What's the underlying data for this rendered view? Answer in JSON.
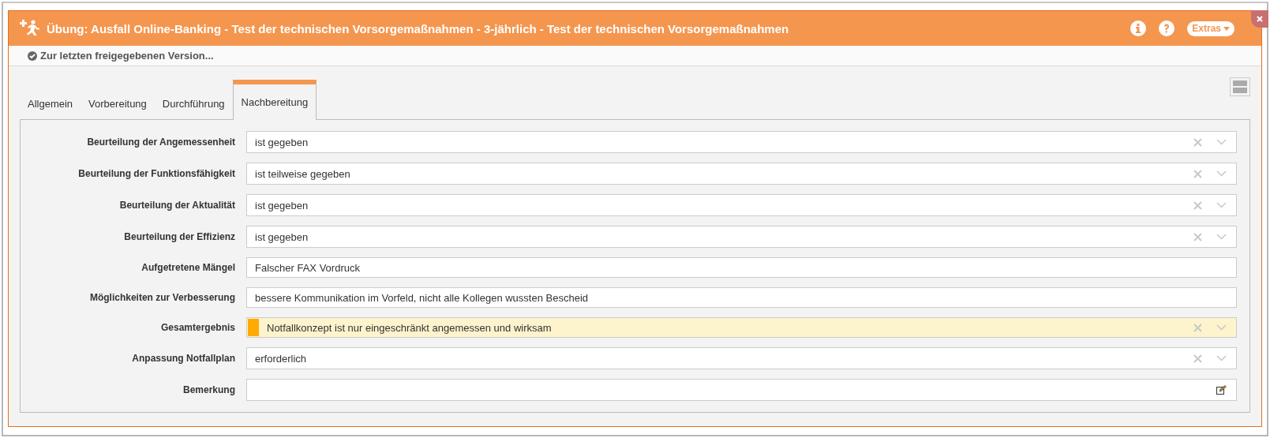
{
  "window": {
    "title": "Übung: Ausfall Online-Banking - Test der technischen Vorsorgemaßnahmen - 3-jährlich - Test der technischen Vorsorgemaßnahmen",
    "extras": "Extras"
  },
  "toolbar": {
    "link": "Zur letzten freigegebenen Version..."
  },
  "tabs": [
    {
      "label": "Allgemein",
      "selected": false
    },
    {
      "label": "Vorbereitung",
      "selected": false
    },
    {
      "label": "Durchführung",
      "selected": false
    },
    {
      "label": "Nachbereitung",
      "selected": true
    }
  ],
  "fields": [
    {
      "kind": "select",
      "label": "Beurteilung der Angemessenheit",
      "value": "ist gegeben"
    },
    {
      "kind": "select",
      "label": "Beurteilung der Funktionsfähigkeit",
      "value": "ist teilweise gegeben"
    },
    {
      "kind": "select",
      "label": "Beurteilung der Aktualität",
      "value": "ist gegeben"
    },
    {
      "kind": "select",
      "label": "Beurteilung der Effizienz",
      "value": "ist gegeben"
    },
    {
      "kind": "text",
      "label": "Aufgetretene Mängel",
      "value": "Falscher FAX Vordruck"
    },
    {
      "kind": "text",
      "label": "Möglichkeiten zur Verbesserung",
      "value": "bessere Kommunikation im Vorfeld, nicht alle Kollegen wussten Bescheid"
    },
    {
      "kind": "rating",
      "label": "Gesamtergebnis",
      "value": "Notfallkonzept ist nur eingeschränkt angemessen und wirksam",
      "color": "#ffaa00"
    },
    {
      "kind": "select",
      "label": "Anpassung Notfallplan",
      "value": "erforderlich"
    },
    {
      "kind": "note",
      "label": "Bemerkung"
    }
  ]
}
